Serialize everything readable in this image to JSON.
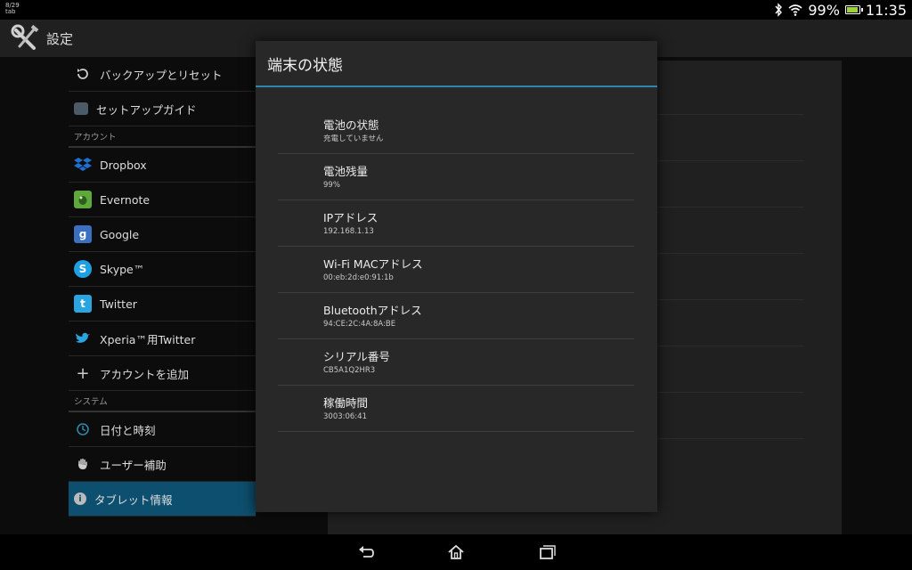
{
  "statusbar": {
    "left_line1": "8/29",
    "left_line2": "tab",
    "battery_pct": "99%",
    "battery_level": 0.99,
    "time": "11:35"
  },
  "actionbar": {
    "title": "設定"
  },
  "sidebar": {
    "items_top": [
      {
        "label": "バックアップとリセット",
        "icon": "restore-icon"
      },
      {
        "label": "セットアップガイド",
        "icon": "setup-guide-icon"
      }
    ],
    "accounts_header": "アカウント",
    "accounts": [
      {
        "label": "Dropbox",
        "icon": "dropbox-icon",
        "color": "#1f6fd1"
      },
      {
        "label": "Evernote",
        "icon": "evernote-icon",
        "color": "#5fa93c"
      },
      {
        "label": "Google",
        "icon": "google-icon",
        "color": "#3b6fc0"
      },
      {
        "label": "Skype™",
        "icon": "skype-icon",
        "color": "#1fa0e3"
      },
      {
        "label": "Twitter",
        "icon": "twitter-icon",
        "color": "#2aa5df"
      },
      {
        "label": "Xperia™用Twitter",
        "icon": "twitter-bird-icon",
        "color": "#2aa5df"
      },
      {
        "label": "アカウントを追加",
        "icon": "plus-icon"
      }
    ],
    "system_header": "システム",
    "system": [
      {
        "label": "日付と時刻",
        "icon": "clock-icon"
      },
      {
        "label": "ユーザー補助",
        "icon": "hand-icon"
      },
      {
        "label": "タブレット情報",
        "icon": "info-icon"
      }
    ]
  },
  "dialog": {
    "title": "端末の状態",
    "rows": [
      {
        "label": "電池の状態",
        "value": "充電していません"
      },
      {
        "label": "電池残量",
        "value": "99%"
      },
      {
        "label": "IPアドレス",
        "value": "192.168.1.13"
      },
      {
        "label": "Wi-Fi MACアドレス",
        "value": "00:eb:2d:e0:91:1b"
      },
      {
        "label": "Bluetoothアドレス",
        "value": "94:CE:2C:4A:8A:BE"
      },
      {
        "label": "シリアル番号",
        "value": "CB5A1Q2HR3"
      },
      {
        "label": "稼働時間",
        "value": "3003:06:41"
      }
    ]
  },
  "colors": {
    "accent": "#2e86ab",
    "selected_bg": "#0d4f6e",
    "battery_fill": "#9bd43a"
  }
}
